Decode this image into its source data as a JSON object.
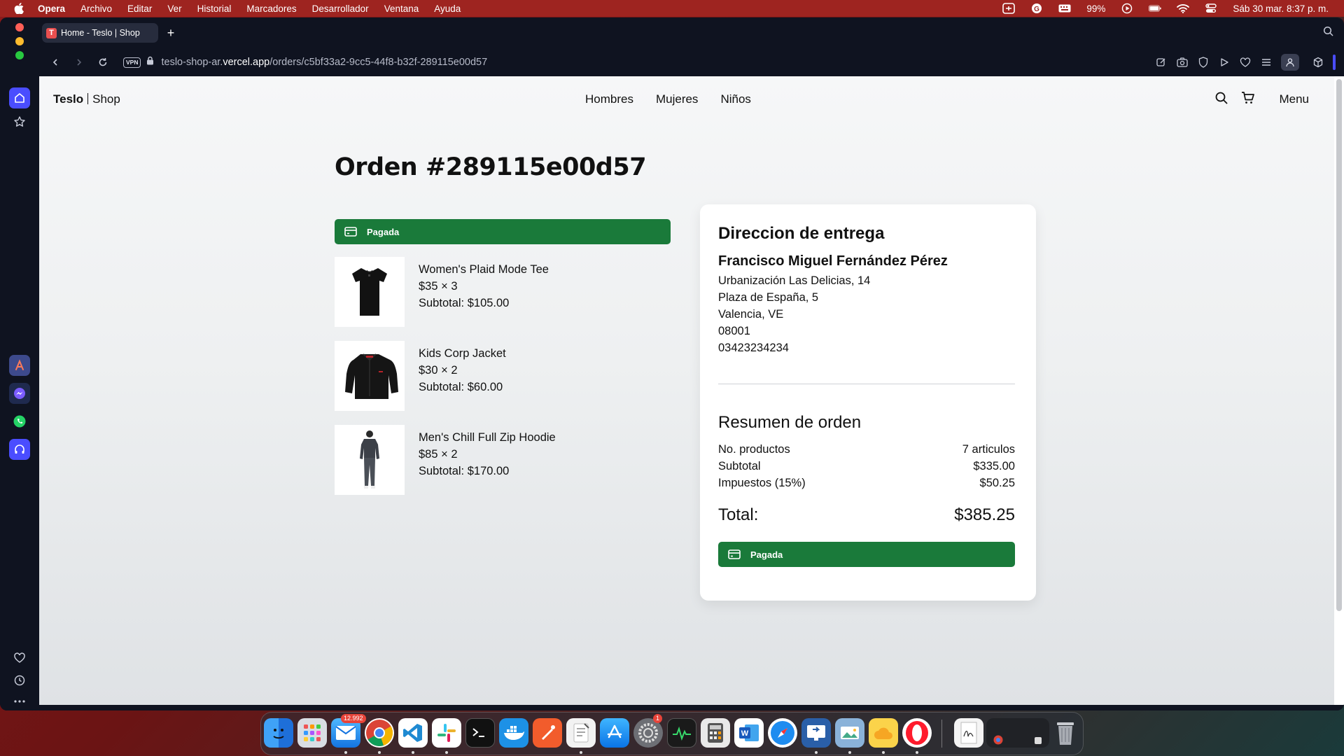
{
  "menubar": {
    "app_name": "Opera",
    "items": [
      "Archivo",
      "Editar",
      "Ver",
      "Historial",
      "Marcadores",
      "Desarrollador",
      "Ventana",
      "Ayuda"
    ],
    "battery": "99%",
    "datetime": "Sáb 30 mar.  8:37 p. m."
  },
  "browser": {
    "tab_title": "Home - Teslo | Shop",
    "favicon_letter": "T",
    "vpn_label": "VPN",
    "url_prefix": "teslo-shop-ar.",
    "url_domain": "vercel.app",
    "url_path": "/orders/c5bf33a2-9cc5-44f8-b32f-289115e00d57"
  },
  "site": {
    "logo_bold": "Teslo",
    "logo_rest": "Shop",
    "nav": [
      "Hombres",
      "Mujeres",
      "Niños"
    ],
    "menu_label": "Menu"
  },
  "order": {
    "title": "Orden #289115e00d57",
    "status_label": "Pagada",
    "items": [
      {
        "name": "Women's Plaid Mode Tee",
        "price_qty": "$35 × 3",
        "subtotal": "Subtotal: $105.00",
        "icon": "tshirt-icon"
      },
      {
        "name": "Kids Corp Jacket",
        "price_qty": "$30 × 2",
        "subtotal": "Subtotal: $60.00",
        "icon": "jacket-icon"
      },
      {
        "name": "Men's Chill Full Zip Hoodie",
        "price_qty": "$85 × 2",
        "subtotal": "Subtotal: $170.00",
        "icon": "person-hoodie-icon"
      }
    ]
  },
  "delivery": {
    "heading": "Direccion de entrega",
    "name": "Francisco Miguel Fernández Pérez",
    "lines": [
      "Urbanización Las Delicias, 14",
      "Plaza de España, 5",
      "Valencia, VE",
      "08001",
      "03423234234"
    ]
  },
  "summary": {
    "heading": "Resumen de orden",
    "rows": [
      {
        "label": "No. productos",
        "value": "7 articulos"
      },
      {
        "label": "Subtotal",
        "value": "$335.00"
      },
      {
        "label": "Impuestos (15%)",
        "value": "$50.25"
      }
    ],
    "total_label": "Total:",
    "total_value": "$385.25",
    "status_label": "Pagada"
  },
  "dock": {
    "mail_badge": "12.992",
    "settings_badge": "1"
  },
  "colors": {
    "paid_green": "#1a7a3a",
    "menubar_red": "#9e2420",
    "window_dark": "#0f1320"
  }
}
